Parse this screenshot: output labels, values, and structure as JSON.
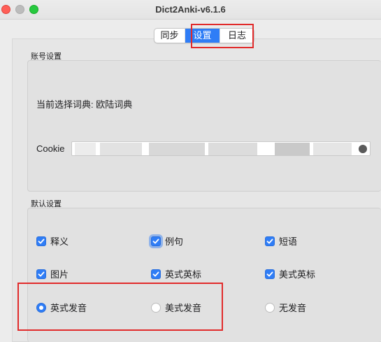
{
  "window": {
    "title": "Dict2Anki-v6.1.6"
  },
  "tabs": [
    {
      "label": "同步",
      "active": false
    },
    {
      "label": "设置",
      "active": true
    },
    {
      "label": "日志",
      "active": false
    }
  ],
  "account": {
    "section_label": "账号设置",
    "dictionary_label": "当前选择词典: 欧陆词典",
    "cookie_label": "Cookie",
    "cookie_value": ""
  },
  "defaults": {
    "section_label": "默认设置",
    "checkboxes": [
      {
        "label": "释义",
        "checked": true
      },
      {
        "label": "例句",
        "checked": true
      },
      {
        "label": "短语",
        "checked": true
      },
      {
        "label": "图片",
        "checked": true
      },
      {
        "label": "英式英标",
        "checked": true
      },
      {
        "label": "美式英标",
        "checked": true
      }
    ],
    "radios": [
      {
        "label": "英式发音",
        "selected": true
      },
      {
        "label": "美式发音",
        "selected": false
      },
      {
        "label": "无发音",
        "selected": false
      }
    ]
  },
  "colors": {
    "accent": "#2f7df6",
    "highlight": "#e12b2b"
  }
}
